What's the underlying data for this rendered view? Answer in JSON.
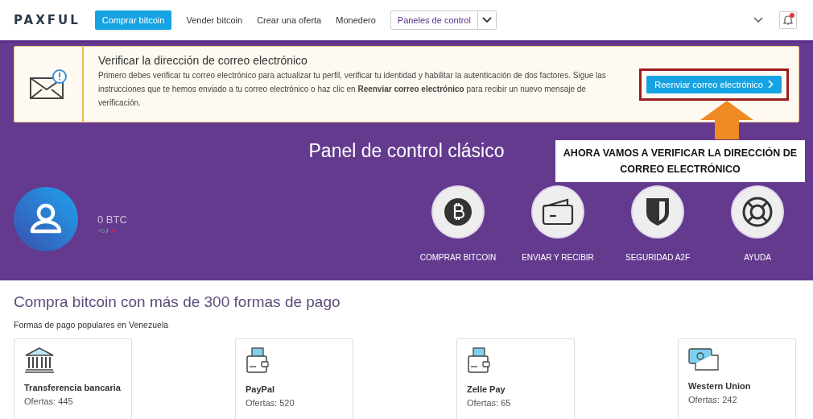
{
  "header": {
    "logo": "PAXFUL",
    "nav": [
      {
        "label": "Comprar bitcoin",
        "selected": true
      },
      {
        "label": "Vender bitcoin",
        "selected": false
      },
      {
        "label": "Crear una oferta",
        "selected": false
      },
      {
        "label": "Monedero",
        "selected": false
      }
    ],
    "dropdown": "Paneles de control",
    "notification_unread": true
  },
  "banner": {
    "title": "Verificar la dirección de correo electrónico",
    "text": "Primero debes verificar tu correo electrónico para actualizar tu perfil, verificar tu identidad y habilitar la autenticación de dos factores. Sigue las instrucciones que te hemos enviado a tu correo electrónico o haz clic en **Reenviar correo electrónico** para recibir un nuevo mensaje de verificación.",
    "button": "Reenviar correo electrónico"
  },
  "annotation": "AHORA VAMOS A VERIFICAR LA DIRECCIÓN DE CORREO ELECTRÓNICO",
  "dashboard": {
    "title": "Panel de control clásico",
    "balance": "0 BTC",
    "gain": "+0",
    "separator": "/",
    "loss": "-0",
    "actions": [
      {
        "label": "COMPRAR BITCOIN",
        "kind": "bitcoin"
      },
      {
        "label": "ENVIAR Y RECIBIR",
        "kind": "wallet"
      },
      {
        "label": "SEGURIDAD A2F",
        "kind": "shield"
      },
      {
        "label": "AYUDA",
        "kind": "lifebuoy"
      }
    ]
  },
  "payments": {
    "heading": "Compra bitcoin con más de 300 formas de pago",
    "subheading": "Formas de pago populares en Venezuela",
    "methods": [
      {
        "name": "Transferencia bancaria",
        "offers": "Ofertas: 445",
        "kind": "bank"
      },
      {
        "name": "PayPal",
        "offers": "Ofertas: 520",
        "kind": "wallet"
      },
      {
        "name": "Zelle Pay",
        "offers": "Ofertas: 65",
        "kind": "wallet"
      },
      {
        "name": "Western Union",
        "offers": "Ofertas: 242",
        "kind": "cash"
      }
    ]
  }
}
